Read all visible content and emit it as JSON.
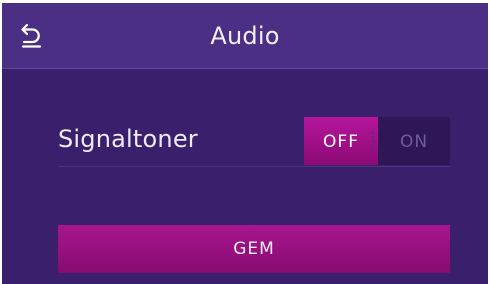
{
  "header": {
    "title": "Audio",
    "back_icon": "undo-arrow-icon"
  },
  "setting": {
    "label": "Signaltoner",
    "toggle": {
      "off_label": "OFF",
      "on_label": "ON",
      "selected": "OFF"
    }
  },
  "save_label": "GEM",
  "colors": {
    "background": "#3a1f6c",
    "header": "#4a2f85",
    "accent": "#a8168f"
  }
}
